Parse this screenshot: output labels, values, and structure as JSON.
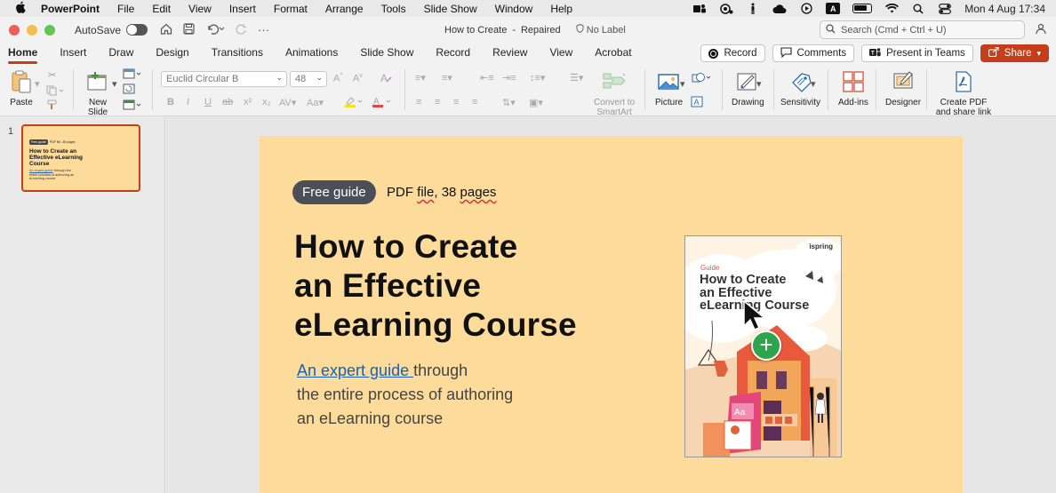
{
  "menubar": {
    "apple": "",
    "items": [
      "PowerPoint",
      "File",
      "Edit",
      "View",
      "Insert",
      "Format",
      "Arrange",
      "Tools",
      "Slide Show",
      "Window",
      "Help"
    ],
    "datetime": "Mon 4 Aug  17:34",
    "input_source": "A"
  },
  "titlebar": {
    "autosave_label": "AutoSave",
    "doc_name": "How to Create",
    "doc_status": "Repaired",
    "label_status": "No Label",
    "search_placeholder": "Search (Cmd + Ctrl + U)"
  },
  "tabs": [
    "Home",
    "Insert",
    "Draw",
    "Design",
    "Transitions",
    "Animations",
    "Slide Show",
    "Record",
    "Review",
    "View",
    "Acrobat"
  ],
  "tab_actions": {
    "record": "Record",
    "comments": "Comments",
    "present": "Present in Teams",
    "share": "Share"
  },
  "ribbon": {
    "paste": "Paste",
    "new_slide_line1": "New",
    "new_slide_line2": "Slide",
    "font_name": "Euclid Circular B",
    "font_size": "48",
    "convert_line1": "Convert to",
    "convert_line2": "SmartArt",
    "picture": "Picture",
    "drawing": "Drawing",
    "sensitivity": "Sensitivity",
    "addins": "Add-ins",
    "designer": "Designer",
    "create_pdf_line1": "Create PDF",
    "create_pdf_line2": "and share link"
  },
  "thumbnail": {
    "number": "1",
    "badge": "Free guide",
    "pdf": "PDF file, 38 pages",
    "title": "How to Create an Effective eLearning Course",
    "link": "An expert guide",
    "sub": "through the entire process of authoring an eLearning course"
  },
  "slide": {
    "badge": "Free guide",
    "pdf_prefix": "PDF ",
    "pdf_word": "file",
    "pdf_suffix": ", 38 ",
    "pdf_pages": "pages",
    "title_line1": "How to Create",
    "title_line2": "an Effective",
    "title_line3": "eLearning Course",
    "sub_link": "An expert guide ",
    "sub_line1_rest": "through",
    "sub_line2": "the entire process of authoring",
    "sub_line3": "an eLearning course",
    "cover": {
      "logo": "ispring",
      "guide": "Guide",
      "title_line1": "How to Create",
      "title_line2": "an Effective",
      "title_line3": "eLearning Course"
    }
  },
  "colors": {
    "accent": "#c43e1c",
    "slide_bg": "#fddc9b",
    "badge_bg": "#4b4f57",
    "link": "#1a5fb4",
    "plus": "#2ea44f"
  }
}
